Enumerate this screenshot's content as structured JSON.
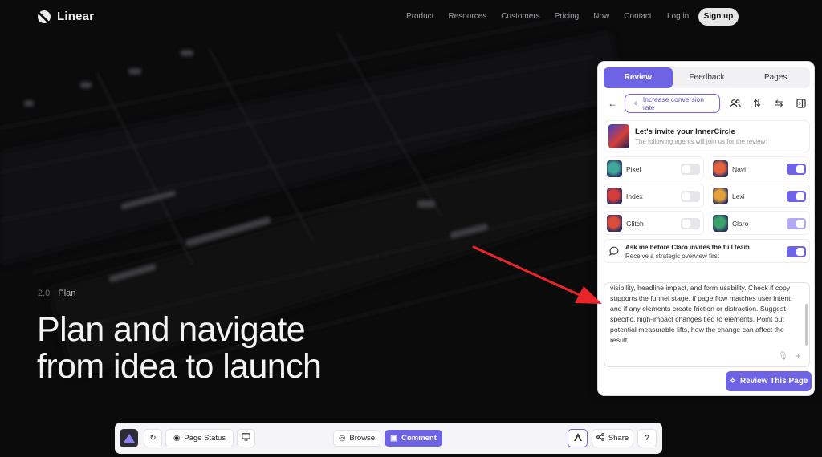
{
  "site": {
    "brand": "Linear",
    "menu": [
      "Product",
      "Resources",
      "Customers",
      "Pricing",
      "Now",
      "Contact"
    ],
    "login": "Log in",
    "signup": "Sign up"
  },
  "hero": {
    "tag_number": "2.0",
    "tag_name": "Plan",
    "headline_line1": "Plan and navigate",
    "headline_line2": "from idea to launch"
  },
  "panel": {
    "tabs": [
      {
        "label": "Review",
        "active": true
      },
      {
        "label": "Feedback",
        "active": false
      },
      {
        "label": "Pages",
        "active": false
      }
    ],
    "goal_pill": "Increase conversion rate",
    "invite_title": "Let's invite your InnerCircle",
    "invite_subtitle": "The following agents will join us for the review:",
    "agents": [
      {
        "name": "Pixel",
        "enabled": false,
        "color": "#3fa89a"
      },
      {
        "name": "Navi",
        "enabled": true,
        "color": "#e2643c"
      },
      {
        "name": "Index",
        "enabled": false,
        "color": "#d43c3c"
      },
      {
        "name": "Lexi",
        "enabled": true,
        "color": "#e3a33a"
      },
      {
        "name": "Glitch",
        "enabled": false,
        "color": "#d94e3a"
      },
      {
        "name": "Claro",
        "enabled": true,
        "color": "#3ba36a"
      }
    ],
    "ask_title": "Ask me before Claro invites the full team",
    "ask_subtitle": "Receive a strategic overview first",
    "ask_enabled": true,
    "prompt_text": "visibility, headline impact, and form usability. Check if copy supports the funnel stage, if page flow matches user intent, and if any elements create friction or distraction. Suggest specific, high-impact changes tied to elements. Point out potential measurable lifts, how the change can affect the result.",
    "review_button": "Review This Page"
  },
  "bottombar": {
    "page_status": "Page Status",
    "browse": "Browse",
    "comment": "Comment",
    "share": "Share"
  },
  "colors": {
    "accent": "#6e62e5",
    "arrow": "#e8262a",
    "background": "#0b0b0c"
  }
}
